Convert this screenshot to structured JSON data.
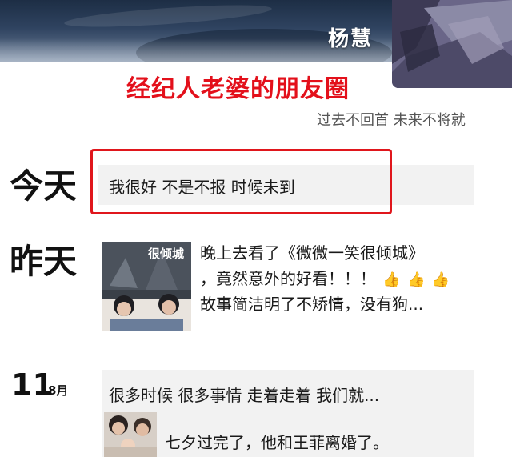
{
  "header": {
    "user_name": "杨慧",
    "overlay_title": "经纪人老婆的朋友圈",
    "signature": "过去不回首 未来不将就"
  },
  "posts": [
    {
      "date_label": "今天",
      "text": "我很好 不是不报 时候未到",
      "highlighted": true
    },
    {
      "date_label": "昨天",
      "text_lines": [
        "晚上去看了《微微一笑很倾城》",
        "，竟然意外的好看！！！",
        "故事简洁明了不矫情，没有狗..."
      ],
      "emojis": [
        "thumbs-up-icon",
        "thumbs-up-icon",
        "thumbs-up-icon"
      ],
      "thumbnail_title": "很倾城"
    },
    {
      "date_day": "11",
      "date_month": "8月",
      "text": "很多时候 很多事情 走着走着 我们就...",
      "shared_text": "七夕过完了，他和王菲离婚了。"
    }
  ],
  "colors": {
    "title_red": "#e3101b",
    "highlight_border": "#e0161c",
    "post_bg": "#f2f2f2",
    "cover_dark": "#1d2e45"
  }
}
